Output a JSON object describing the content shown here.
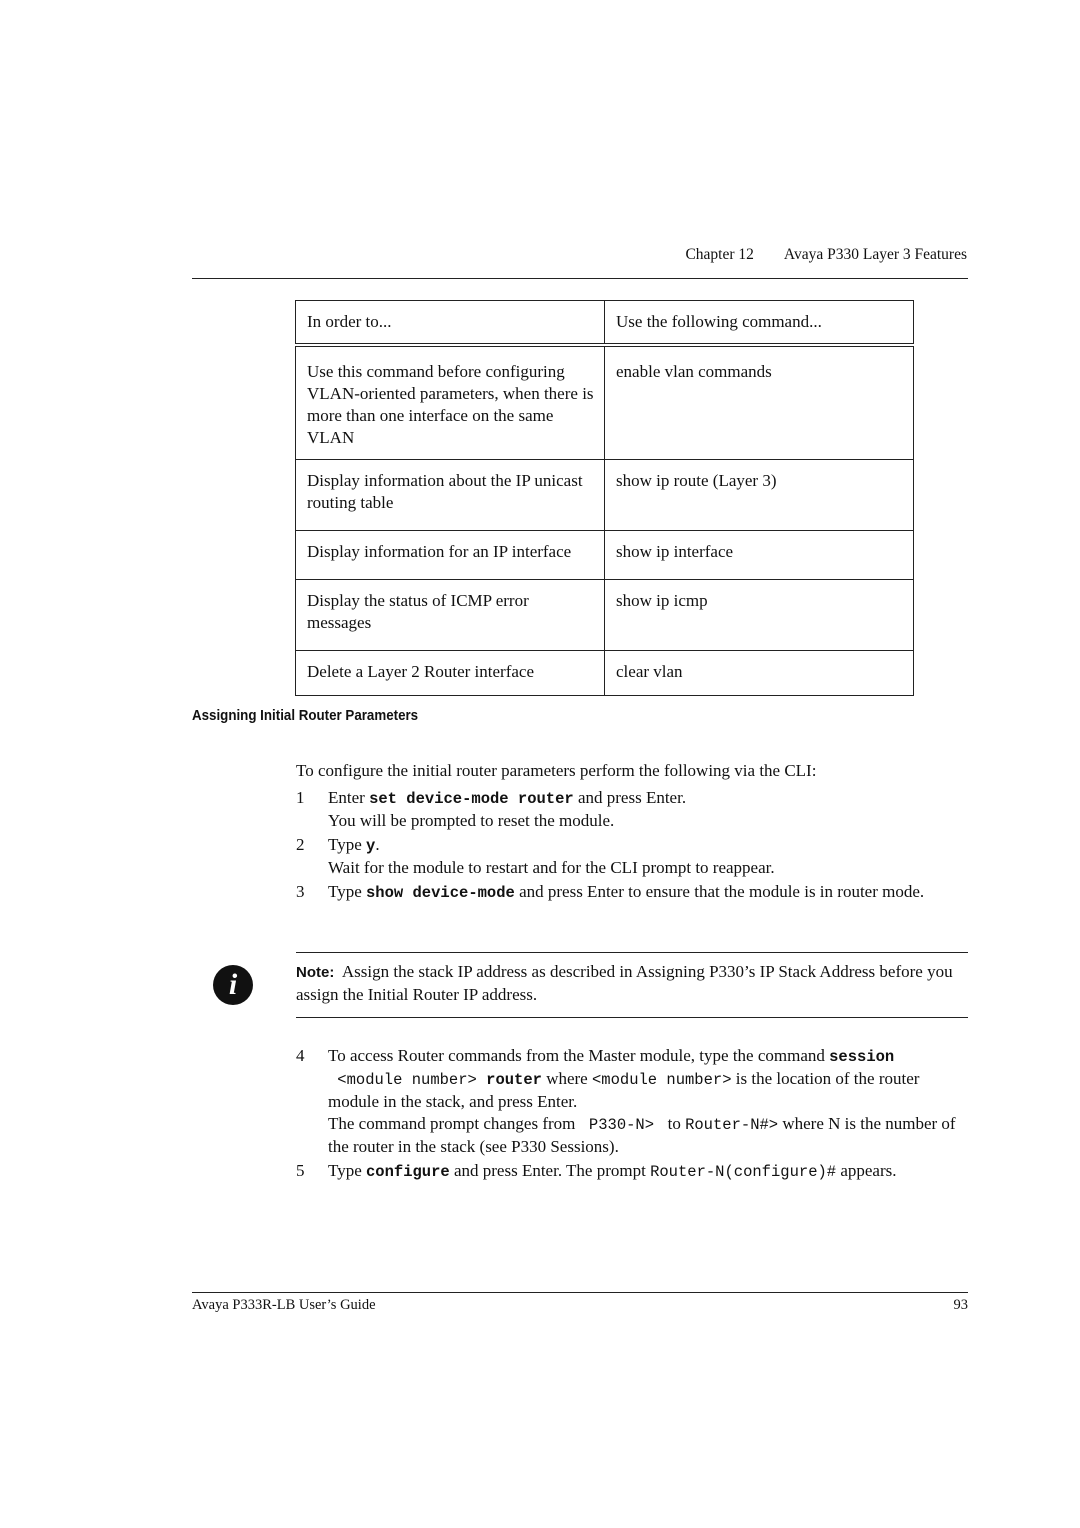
{
  "header": {
    "chapter": "Chapter 12",
    "title": "Avaya P330 Layer 3 Features"
  },
  "table": {
    "columns": [
      "In order to...",
      "Use the following command..."
    ],
    "rows": [
      {
        "purpose": "Use this command before configuring VLAN-oriented parameters, when there is more than one interface on the same VLAN",
        "command": "enable vlan commands"
      },
      {
        "purpose": "Display information about the IP unicast routing table",
        "command": "show ip route (Layer 3)"
      },
      {
        "purpose": "Display information for an IP interface",
        "command": "show ip interface"
      },
      {
        "purpose": "Display the status of ICMP error messages",
        "command": "show ip icmp"
      },
      {
        "purpose": "Delete a Layer 2 Router interface",
        "command": "clear vlan"
      }
    ]
  },
  "section": {
    "title": "Assigning Initial Router Parameters",
    "intro": "To configure the initial router parameters perform the following via the CLI:",
    "steps_a": [
      {
        "num": "1",
        "pre": "Enter ",
        "code": "set device-mode router",
        "post": " and press Enter.",
        "extra": "You will be prompted to reset the module."
      },
      {
        "num": "2",
        "pre": "Type ",
        "code": "y",
        "post": ".",
        "extra": "Wait for the module to restart and for the CLI prompt to reappear."
      },
      {
        "num": "3",
        "pre": "Type ",
        "code": "show device-mode",
        "post": " and press Enter to ensure that the module is in router mode.",
        "extra": ""
      }
    ],
    "note": {
      "icon": "info-icon",
      "label": "Note:",
      "text": "Assign the stack IP address as described in Assigning P330’s IP Stack Address before you assign the Initial Router IP address."
    },
    "step4": {
      "num": "4",
      "t1": "To access Router commands from the Master module, type the command ",
      "c1": "session",
      "c2": " <module number> ",
      "c3": "router",
      "t2": " where ",
      "c4": "<module number>",
      "t3": " is the location of the router module in the stack, and press Enter.",
      "t4": "The command prompt changes from ",
      "c5": " P330-N> ",
      "t5": " to ",
      "c6": "Router-N#>",
      "t6": " where N is the number of the router in the stack (see P330 Sessions)."
    },
    "step5": {
      "num": "5",
      "t1": "Type ",
      "c1": "configure",
      "t2": " and press Enter. The prompt ",
      "c2": "Router-N(configure)#",
      "t3": " appears."
    }
  },
  "footer": {
    "guide": "Avaya P333R-LB User’s Guide",
    "page": "93"
  }
}
